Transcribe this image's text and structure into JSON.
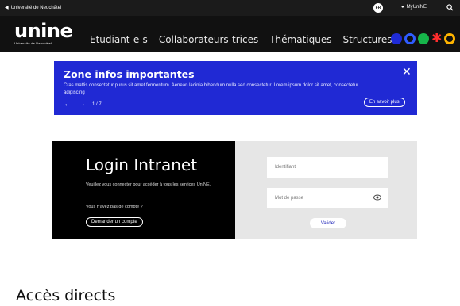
{
  "topbar": {
    "back_label": "Université de Neuchâtel",
    "language": "FR",
    "account_label": "MyUniNE"
  },
  "header": {
    "logo_word": "unine",
    "logo_sub": "Université de Neuchâtel",
    "nav": [
      "Etudiant-e-s",
      "Collaborateurs-trices",
      "Thématiques",
      "Structures"
    ],
    "brand_colors": [
      "#1f2bd6",
      "#2f5cff",
      "#16b54a",
      "#ff2d2d",
      "#ffb400"
    ]
  },
  "banner": {
    "title": "Zone infos importantes",
    "body": "Cras mattis consectetur purus sit amet fermentum. Aenean lacinia bibendum nulla sed consectetur. Lorem ipsum dolor sit amet, consectetur adipiscing",
    "pager": "1 / 7",
    "more_label": "En savoir plus",
    "color": "#2029d4"
  },
  "login": {
    "title": "Login Intranet",
    "description": "Veuillez vous connecter pour accéder à tous les services UniNE.",
    "no_account": "Vous n'avez pas de compte ?",
    "request_label": "Demander un compte",
    "id_placeholder": "Identifiant",
    "password_placeholder": "Mot de passe",
    "validate_label": "Valider"
  },
  "section": {
    "title": "Accès directs"
  }
}
